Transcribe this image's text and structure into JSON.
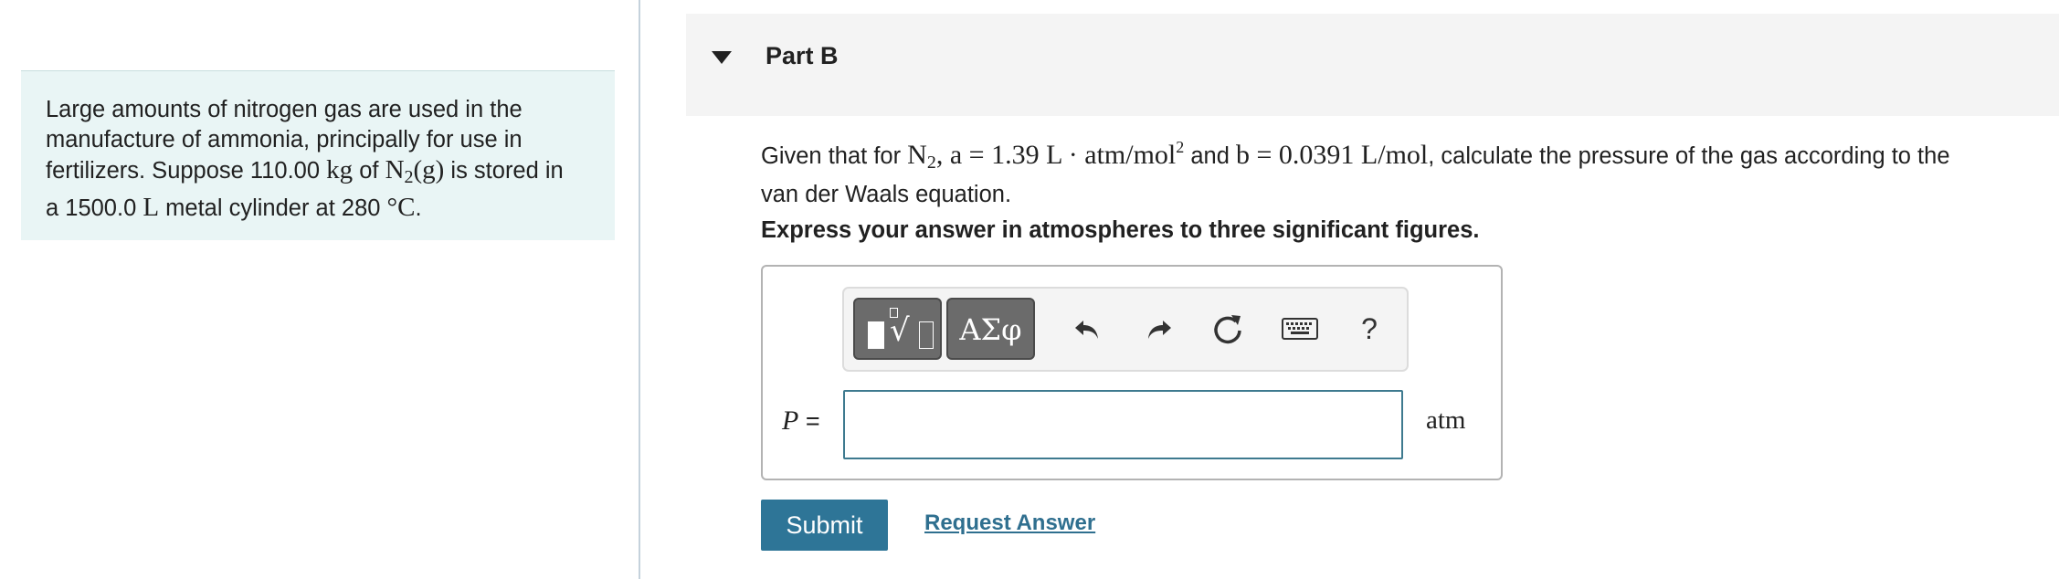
{
  "info_panel": {
    "line1": "Large amounts of nitrogen gas are used in the",
    "line2": "manufacture of ammonia, principally for use in",
    "line3_a": "fertilizers. Suppose 110.00 ",
    "line3_unit_kg": "kg",
    "line3_b": " of ",
    "line3_n": "N",
    "line3_sub": "2",
    "line3_g": "(g)",
    "line3_c": " is stored in",
    "line4_a": "a 1500.0 ",
    "line4_unit_l": "L",
    "line4_b": " metal cylinder at 280 ",
    "line4_degc": "°C",
    "line4_end": "."
  },
  "part": {
    "title": "Part B"
  },
  "question": {
    "pre": "Given that for ",
    "n": "N",
    "n_sub": "2",
    "a_expr": ", a = 1.39 L · atm/mol",
    "a_sup": "2",
    "and": " and ",
    "b_expr": "b = 0.0391 L/mol",
    "post": ", calculate the pressure of the gas according to the",
    "line2": "van der Waals equation."
  },
  "instruction": "Express your answer in atmospheres to three significant figures.",
  "toolbar": {
    "symbols_label": "ΑΣφ",
    "help_label": "?"
  },
  "answer": {
    "variable": "P",
    "equals": " =",
    "value": "",
    "unit": "atm"
  },
  "actions": {
    "submit_label": "Submit",
    "request_answer_label": "Request Answer"
  },
  "colors": {
    "info_bg": "#e9f5f5",
    "submit_bg": "#2e7597",
    "link": "#2f6f8f",
    "input_border": "#3e7a8f"
  }
}
